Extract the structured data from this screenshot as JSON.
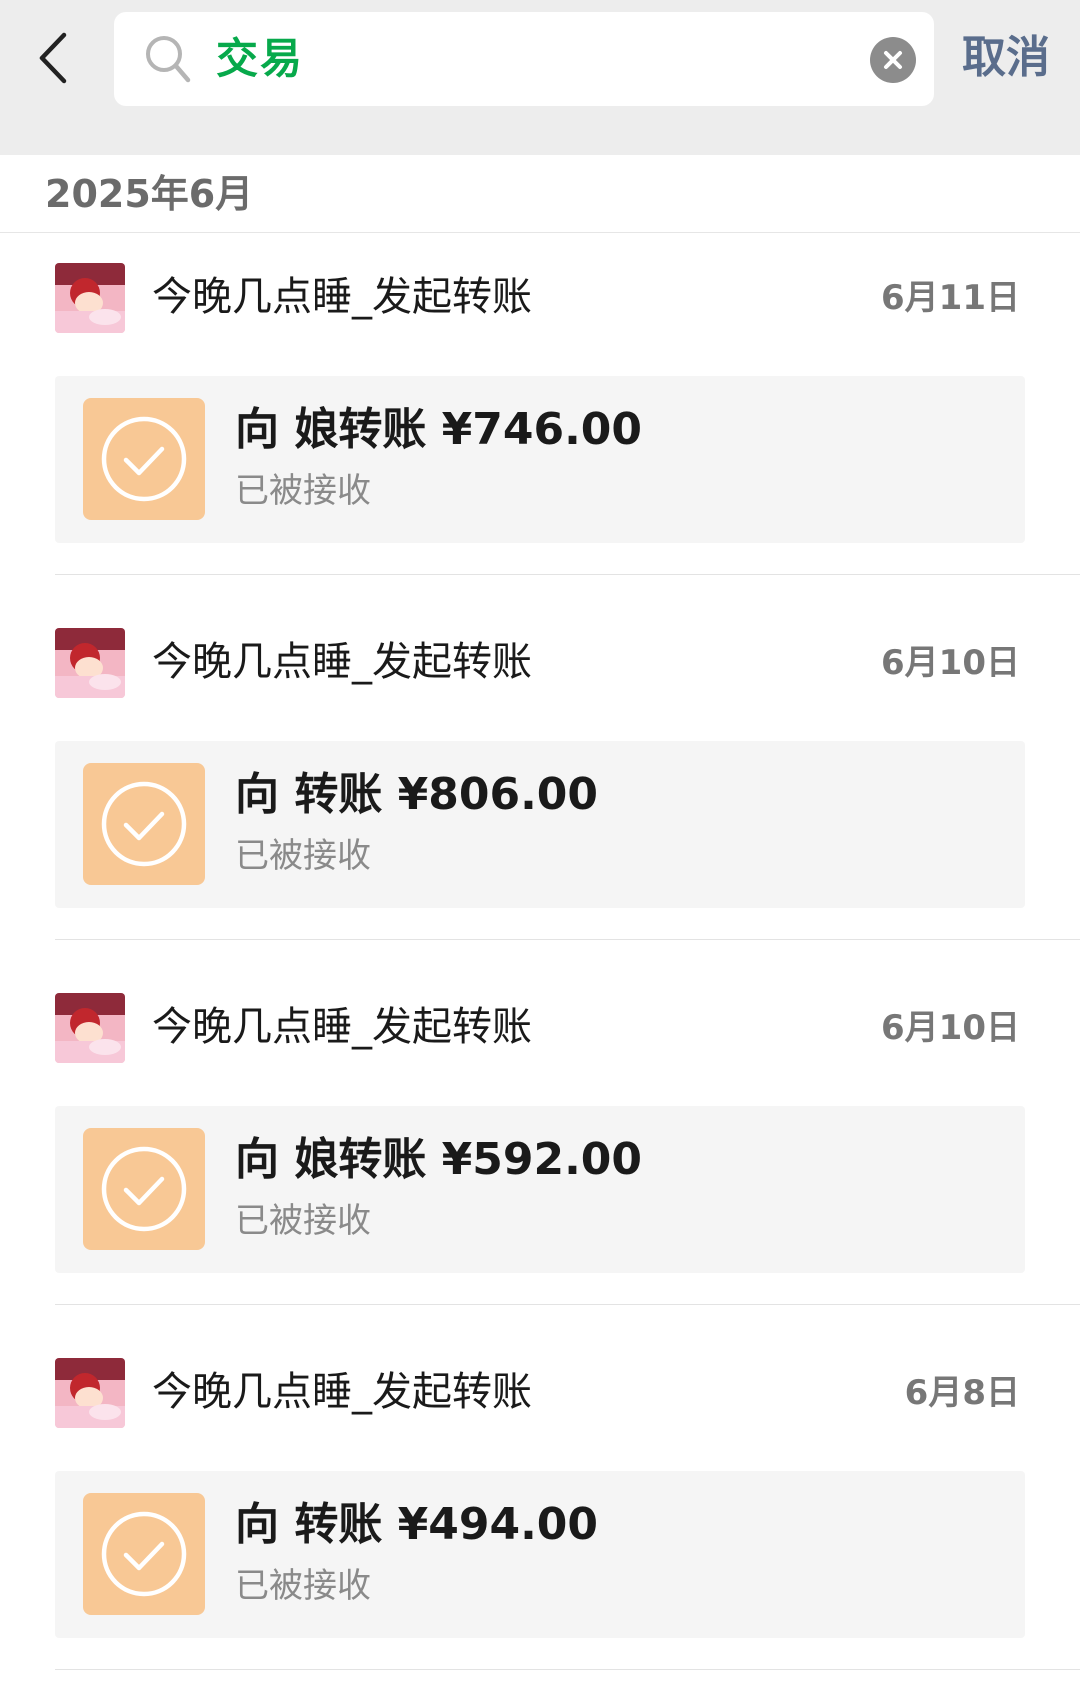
{
  "header": {
    "search_query": "交易",
    "cancel_label": "取消"
  },
  "month_label": "2025年6月",
  "colors": {
    "search_text": "#07a94b",
    "cancel": "#5a6d8c",
    "transfer_tile": "#f8c895"
  },
  "records": [
    {
      "chat_name": "今晚几点睡_发起转账",
      "date": "6月11日",
      "title": "向    娘转账 ¥746.00",
      "status": "已被接收"
    },
    {
      "chat_name": "今晚几点睡_发起转账",
      "date": "6月10日",
      "title": "向    转账 ¥806.00",
      "status": "已被接收"
    },
    {
      "chat_name": "今晚几点睡_发起转账",
      "date": "6月10日",
      "title": "向    娘转账 ¥592.00",
      "status": "已被接收"
    },
    {
      "chat_name": "今晚几点睡_发起转账",
      "date": "6月8日",
      "title": "向    转账 ¥494.00",
      "status": "已被接收"
    }
  ]
}
